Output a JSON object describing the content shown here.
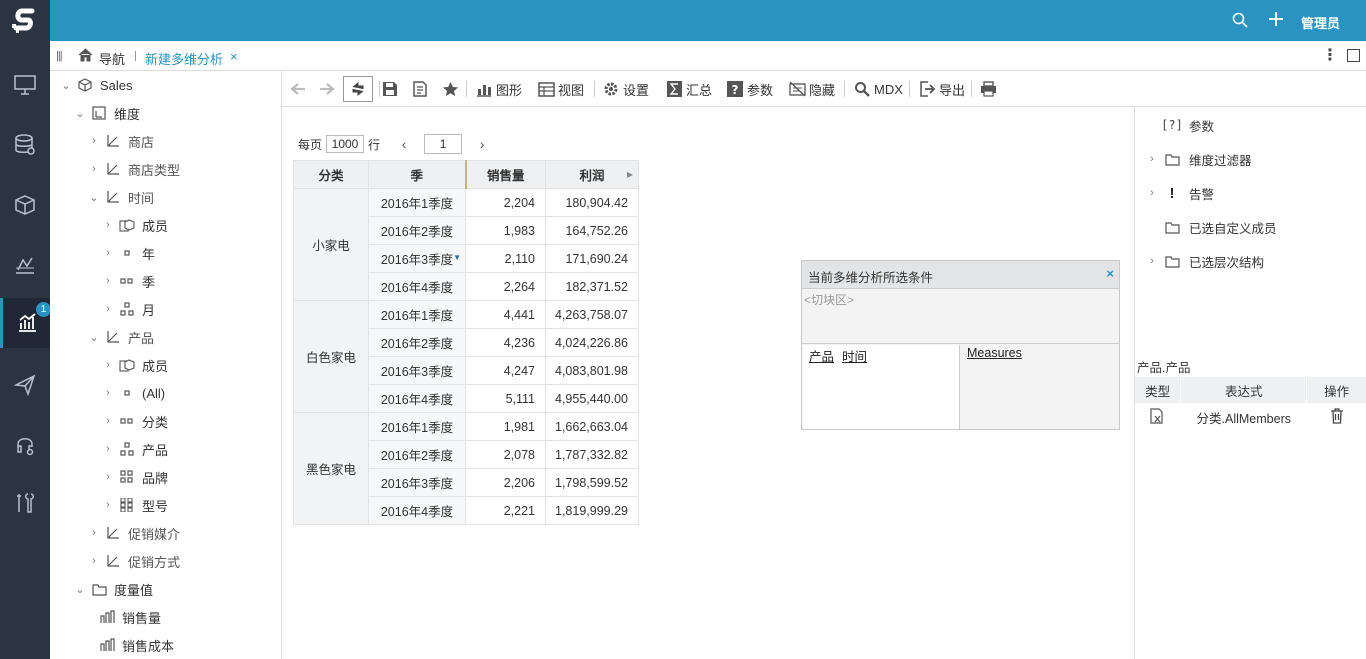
{
  "app": {
    "brand_color": "#2a93c1",
    "nav_bg": "#2b3542"
  },
  "leftnav": {
    "icons": [
      "monitor-icon",
      "database-icon",
      "cube-icon",
      "chart-paper-icon",
      "analysis-chart-icon",
      "send-icon",
      "headset-icon",
      "tools-icon"
    ],
    "active_index": 4,
    "badge": "1"
  },
  "topbar": {
    "user_label": "管理员"
  },
  "tabs": {
    "nav_label": "导航",
    "active_tab": "新建多维分析",
    "close": "×"
  },
  "tree": {
    "cube": "Sales",
    "dimensions_label": "维度",
    "items": [
      {
        "label": "商店"
      },
      {
        "label": "商店类型"
      },
      {
        "label": "时间"
      },
      {
        "label": "成员"
      },
      {
        "label": "年"
      },
      {
        "label": "季"
      },
      {
        "label": "月"
      },
      {
        "label": "产品"
      },
      {
        "label": "成员"
      },
      {
        "label": "(All)"
      },
      {
        "label": "分类"
      },
      {
        "label": "产品"
      },
      {
        "label": "品牌"
      },
      {
        "label": "型号"
      },
      {
        "label": "促销媒介"
      },
      {
        "label": "促销方式"
      }
    ],
    "measures_label": "度量值",
    "measures": [
      "销售量",
      "销售成本"
    ]
  },
  "toolbar": {
    "chart": "图形",
    "view": "视图",
    "settings": "设置",
    "summary": "汇总",
    "params": "参数",
    "hide": "隐藏",
    "mdx": "MDX",
    "export": "导出"
  },
  "pager": {
    "per_page_label": "每页",
    "per_page_value": "1000",
    "row_label": "行",
    "page_value": "1",
    "prev": "‹",
    "next": "›"
  },
  "pivot": {
    "headers": {
      "category": "分类",
      "season": "季",
      "qty": "销售量",
      "profit": "利润"
    },
    "groups": [
      {
        "name": "小家电",
        "rows": [
          {
            "q": "2016年1季度",
            "qty": "2,204",
            "profit": "180,904.42"
          },
          {
            "q": "2016年2季度",
            "qty": "1,983",
            "profit": "164,752.26"
          },
          {
            "q": "2016年3季度",
            "qty": "2,110",
            "profit": "171,690.24"
          },
          {
            "q": "2016年4季度",
            "qty": "2,264",
            "profit": "182,371.52"
          }
        ]
      },
      {
        "name": "白色家电",
        "rows": [
          {
            "q": "2016年1季度",
            "qty": "4,441",
            "profit": "4,263,758.07"
          },
          {
            "q": "2016年2季度",
            "qty": "4,236",
            "profit": "4,024,226.86"
          },
          {
            "q": "2016年3季度",
            "qty": "4,247",
            "profit": "4,083,801.98"
          },
          {
            "q": "2016年4季度",
            "qty": "5,111",
            "profit": "4,955,440.00"
          }
        ]
      },
      {
        "name": "黑色家电",
        "rows": [
          {
            "q": "2016年1季度",
            "qty": "1,981",
            "profit": "1,662,663.04"
          },
          {
            "q": "2016年2季度",
            "qty": "2,078",
            "profit": "1,787,332.82"
          },
          {
            "q": "2016年3季度",
            "qty": "2,206",
            "profit": "1,798,599.52"
          },
          {
            "q": "2016年4季度",
            "qty": "2,221",
            "profit": "1,819,999.29"
          }
        ]
      }
    ]
  },
  "conditions": {
    "title": "当前多维分析所选条件",
    "close": "×",
    "slicer": "<切块区>",
    "rows": [
      "产品",
      "时间"
    ],
    "cols": [
      "Measures"
    ]
  },
  "rpanel": {
    "items": [
      {
        "label": "参数",
        "icon": "param-icon",
        "expandable": false
      },
      {
        "label": "维度过滤器",
        "icon": "folder-icon",
        "expandable": true
      },
      {
        "label": "告警",
        "icon": "exclamation-icon",
        "expandable": true
      },
      {
        "label": "已选自定义成员",
        "icon": "folder-icon",
        "expandable": false
      },
      {
        "label": "已选层次结构",
        "icon": "folder-icon",
        "expandable": true
      }
    ],
    "expr_title": "产品.产品",
    "expr_headers": {
      "type": "类型",
      "expr": "表达式",
      "op": "操作"
    },
    "expr_rows": [
      {
        "expr": "分类.AllMembers"
      }
    ]
  }
}
